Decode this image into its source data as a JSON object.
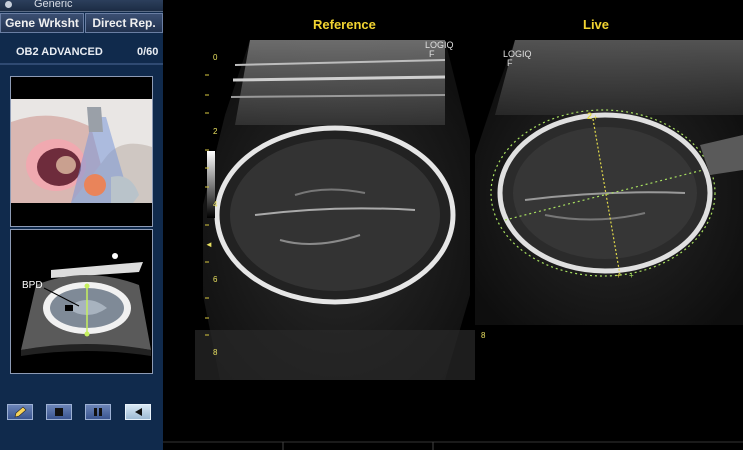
{
  "header": {
    "tab_title": "Generic",
    "tabs": [
      "Gene Wrksht",
      "Direct Rep."
    ],
    "protocol": "OB2  ADVANCED",
    "count": "0/60"
  },
  "diagram": {
    "measure_label": "BPD"
  },
  "views": {
    "reference_label": "Reference",
    "live_label": "Live",
    "logo_line1": "LOGIQ",
    "logo_line2": "F",
    "marker_label": "2"
  },
  "depth_scale": {
    "marks": [
      "0",
      "2",
      "4",
      "6",
      "8"
    ],
    "right_mark": "8"
  },
  "controls": {
    "icons": [
      "pencil-icon",
      "stop-icon",
      "pause-icon",
      "play-icon"
    ]
  },
  "colors": {
    "label_yellow": "#f2d431",
    "caliper_green": "#a8e060",
    "panel_blue": "#102a4c"
  }
}
